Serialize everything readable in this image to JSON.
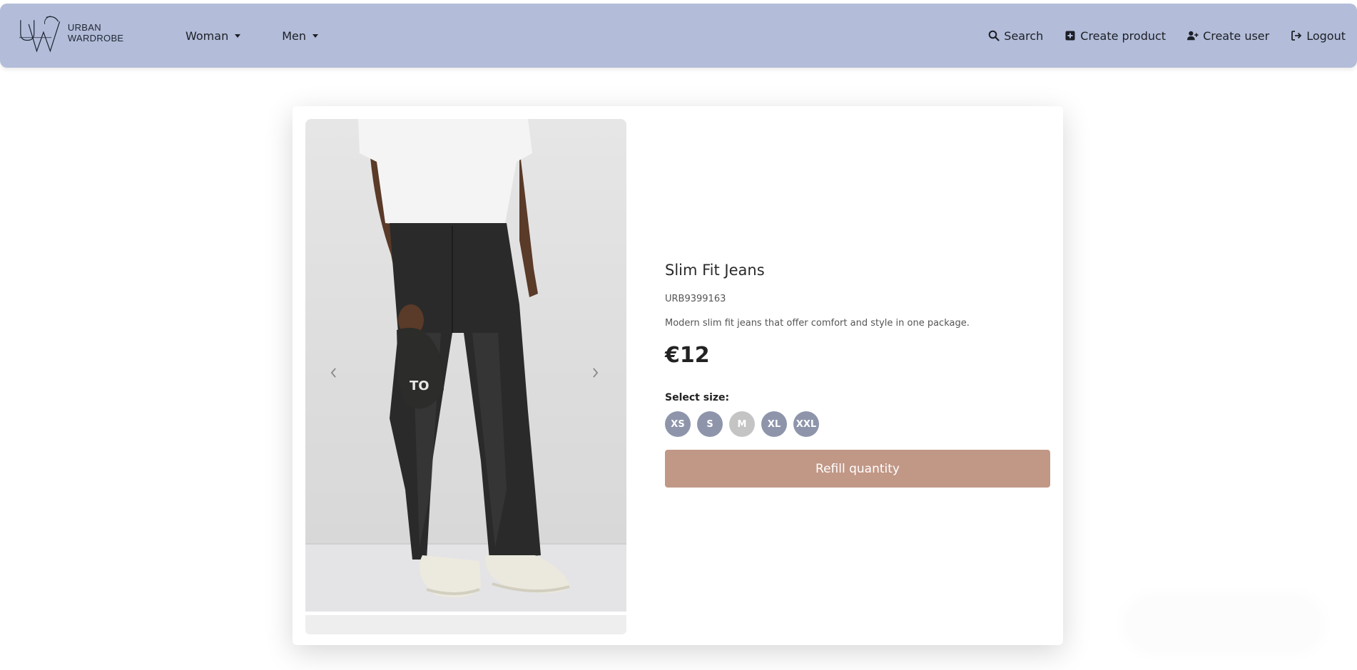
{
  "navbar": {
    "brand_text": "URBAN WARDROBE",
    "left_items": [
      {
        "label": "Woman",
        "icon": "caret-down-icon"
      },
      {
        "label": "Men",
        "icon": "caret-down-icon"
      }
    ],
    "right_items": [
      {
        "label": "Search",
        "icon": "search-icon"
      },
      {
        "label": "Create product",
        "icon": "plus-square-icon"
      },
      {
        "label": "Create user",
        "icon": "user-plus-icon"
      },
      {
        "label": "Logout",
        "icon": "logout-icon"
      }
    ],
    "background_color": "#b3bdd9"
  },
  "product": {
    "name": "Slim Fit Jeans",
    "code": "URB9399163",
    "description": "Modern slim fit jeans that offer comfort and style in one package.",
    "price": "€12",
    "size_label": "Select size:",
    "sizes": [
      {
        "label": "XS",
        "available": true
      },
      {
        "label": "S",
        "available": true
      },
      {
        "label": "M",
        "available": false
      },
      {
        "label": "XL",
        "available": true
      },
      {
        "label": "XXL",
        "available": true
      }
    ],
    "action_label": "Refill quantity",
    "action_color": "#c19786",
    "size_color": "#8e95ab"
  }
}
